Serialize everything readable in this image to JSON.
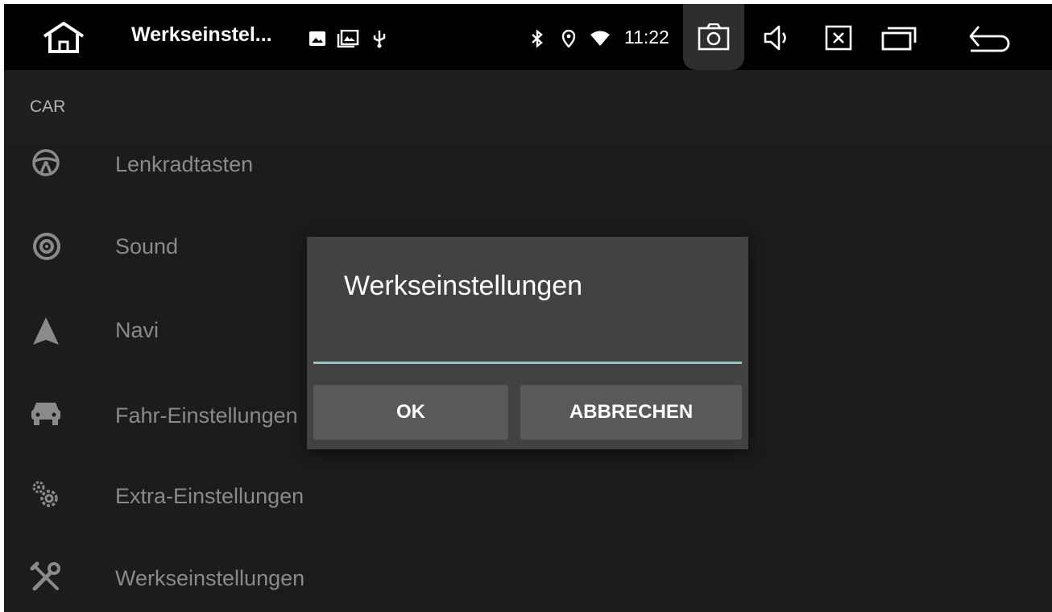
{
  "status_bar": {
    "app_title": "Werkseinstel...",
    "time": "11:22",
    "notification_icons": [
      "image-icon",
      "gallery-icon",
      "usb-icon"
    ],
    "status_icons": [
      "bluetooth-icon",
      "location-icon",
      "wifi-icon"
    ],
    "nav_buttons": [
      "camera-icon",
      "volume-icon",
      "close-app-icon",
      "recent-apps-icon",
      "back-icon"
    ]
  },
  "section": {
    "header": "CAR"
  },
  "list": {
    "items": [
      {
        "label": "Lenkradtasten",
        "icon": "steering-wheel-icon"
      },
      {
        "label": "Sound",
        "icon": "speaker-icon"
      },
      {
        "label": "Navi",
        "icon": "navigation-arrow-icon"
      },
      {
        "label": "Fahr-Einstellungen",
        "icon": "car-icon"
      },
      {
        "label": "Extra-Einstellungen",
        "icon": "gears-icon"
      },
      {
        "label": "Werkseinstellungen",
        "icon": "tools-icon"
      }
    ]
  },
  "dialog": {
    "title": "Werkseinstellungen",
    "input_value": "",
    "ok_label": "OK",
    "cancel_label": "ABBRECHEN",
    "accent_color": "#7ecfc4"
  },
  "colors": {
    "status_bar_bg": "#000000",
    "background": "#1c1c1c",
    "dialog_bg": "#424242",
    "button_bg": "#595959"
  }
}
